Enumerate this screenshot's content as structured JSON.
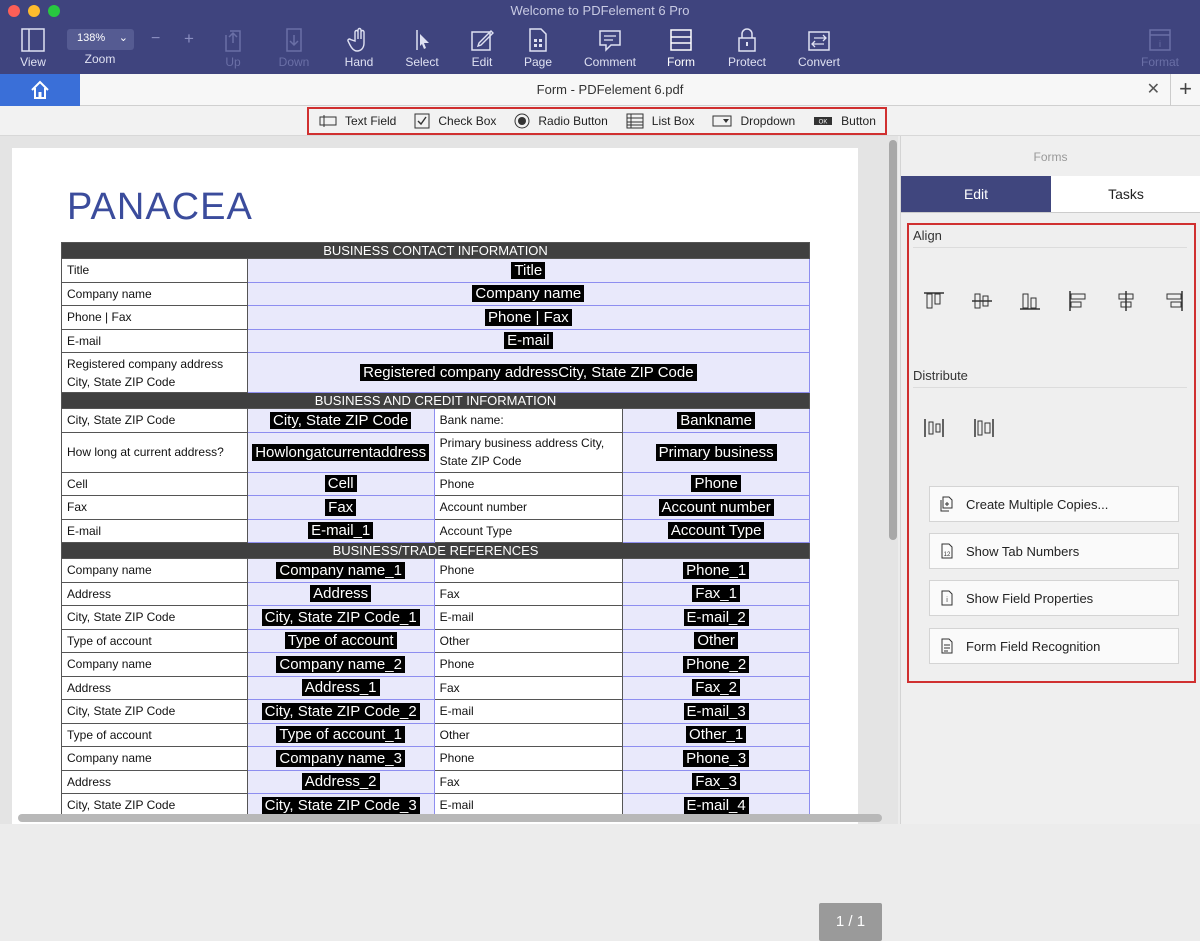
{
  "window": {
    "title": "Welcome to PDFelement 6 Pro"
  },
  "toolbar": {
    "zoom_value": "138%",
    "zoom_minus": "−",
    "zoom_plus": "+",
    "items": [
      {
        "label": "View",
        "icon": "view-icon"
      },
      {
        "label": "Zoom",
        "icon": "zoom-icon"
      },
      {
        "label": "Up",
        "icon": "up-icon"
      },
      {
        "label": "Down",
        "icon": "down-icon"
      },
      {
        "label": "Hand",
        "icon": "hand-icon"
      },
      {
        "label": "Select",
        "icon": "select-icon"
      },
      {
        "label": "Edit",
        "icon": "edit-icon"
      },
      {
        "label": "Page",
        "icon": "page-icon"
      },
      {
        "label": "Comment",
        "icon": "comment-icon"
      },
      {
        "label": "Form",
        "icon": "form-icon"
      },
      {
        "label": "Protect",
        "icon": "protect-icon"
      },
      {
        "label": "Convert",
        "icon": "convert-icon"
      },
      {
        "label": "Format",
        "icon": "format-icon"
      }
    ]
  },
  "tab": {
    "title": "Form - PDFelement 6.pdf",
    "close": "✕",
    "add": "+"
  },
  "form_tools": [
    "Text Field",
    "Check Box",
    "Radio Button",
    "List Box",
    "Dropdown",
    "Button"
  ],
  "document": {
    "logo": "PANACEA",
    "page_indicator": "1 / 1",
    "sections": {
      "contact": "BUSINESS CONTACT INFORMATION",
      "credit": "BUSINESS AND CREDIT INFORMATION",
      "refs": "BUSINESS/TRADE REFERENCES"
    },
    "contact_rows": [
      {
        "label": "Title",
        "field": "Title"
      },
      {
        "label": "Company name",
        "field": "Company name"
      },
      {
        "label": "Phone | Fax",
        "field": "Phone | Fax"
      },
      {
        "label": "E-mail",
        "field": "E-mail"
      },
      {
        "label": "Registered company address City, State ZIP Code",
        "field": "Registered company addressCity, State ZIP Code"
      }
    ],
    "credit_rows": [
      {
        "l1": "City, State ZIP Code",
        "f1": "City, State ZIP Code",
        "l2": "Bank name:",
        "f2": "Bankname"
      },
      {
        "l1": "How long at current address?",
        "f1": "Howlongatcurrentaddress",
        "l2": "Primary business address City, State ZIP Code",
        "f2": "Primary business"
      },
      {
        "l1": "Cell",
        "f1": "Cell",
        "l2": "Phone",
        "f2": "Phone"
      },
      {
        "l1": "Fax",
        "f1": "Fax",
        "l2": "Account number",
        "f2": "Account number"
      },
      {
        "l1": "E-mail",
        "f1": "E-mail_1",
        "l2": "Account Type",
        "f2": "Account Type"
      }
    ],
    "ref_rows": [
      {
        "l1": "Company name",
        "f1": "Company name_1",
        "l2": "Phone",
        "f2": "Phone_1"
      },
      {
        "l1": "Address",
        "f1": "Address",
        "l2": "Fax",
        "f2": "Fax_1"
      },
      {
        "l1": "City, State ZIP Code",
        "f1": "City, State ZIP Code_1",
        "l2": "E-mail",
        "f2": "E-mail_2"
      },
      {
        "l1": "Type of account",
        "f1": "Type of account",
        "l2": "Other",
        "f2": "Other"
      },
      {
        "l1": "Company name",
        "f1": "Company name_2",
        "l2": "Phone",
        "f2": "Phone_2"
      },
      {
        "l1": "Address",
        "f1": "Address_1",
        "l2": "Fax",
        "f2": "Fax_2"
      },
      {
        "l1": "City, State ZIP Code",
        "f1": "City, State ZIP Code_2",
        "l2": "E-mail",
        "f2": "E-mail_3"
      },
      {
        "l1": "Type of account",
        "f1": "Type of account_1",
        "l2": "Other",
        "f2": "Other_1"
      },
      {
        "l1": "Company name",
        "f1": "Company name_3",
        "l2": "Phone",
        "f2": "Phone_3"
      },
      {
        "l1": "Address",
        "f1": "Address_2",
        "l2": "Fax",
        "f2": "Fax_3"
      },
      {
        "l1": "City, State ZIP Code",
        "f1": "City, State ZIP Code_3",
        "l2": "E-mail",
        "f2": "E-mail_4"
      }
    ]
  },
  "panel": {
    "title": "Forms",
    "tabs": [
      "Edit",
      "Tasks"
    ],
    "align_label": "Align",
    "distribute_label": "Distribute",
    "buttons": [
      "Create Multiple Copies...",
      "Show Tab Numbers",
      "Show Field Properties",
      "Form Field Recognition"
    ]
  }
}
